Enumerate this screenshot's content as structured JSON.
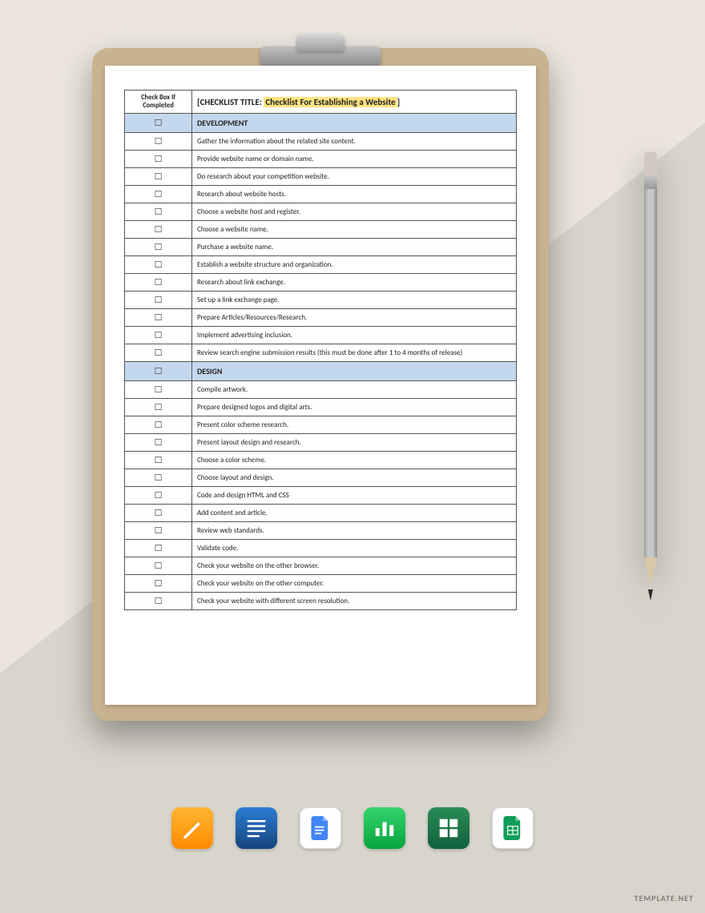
{
  "header": {
    "check_col_label": "Check Box If Completed",
    "title_prefix": "[CHECKLIST TITLE: ",
    "title_highlight": "Checklist For Establishing a Website",
    "title_suffix": "]"
  },
  "sections": [
    {
      "name": "DEVELOPMENT",
      "items": [
        "Gather the information about the related site content.",
        "Provide website name or domain name.",
        "Do research about your competition website.",
        "Research about website hosts.",
        "Choose a website host and register.",
        "Choose a website name.",
        "Purchase a website name.",
        "Establish a website structure and organization.",
        "Research about link exchange.",
        "Set up a link exchange page.",
        "Prepare Articles/Resources/Research.",
        "Implement advertising inclusion.",
        "Review search engine submission results (this must be done after 1 to 4 months of release)"
      ]
    },
    {
      "name": "DESIGN",
      "items": [
        "Compile artwork.",
        "Prepare designed logos and digital arts.",
        "Present color scheme research.",
        "Present layout design and research.",
        "Choose a color scheme.",
        "Choose layout and design.",
        "Code and design HTML and CSS",
        "Add content and article.",
        "Review web standards.",
        "Validate code.",
        "Check your website on the other browser.",
        "Check your website on the other computer.",
        "Check your website with different screen resolution."
      ]
    }
  ],
  "apps": {
    "pages": "pages-icon",
    "word": "word-icon",
    "gdocs": "google-docs-icon",
    "numbers": "numbers-icon",
    "excel": "excel-icon",
    "gsheets": "google-sheets-icon"
  },
  "watermark": "TEMPLATE.NET"
}
